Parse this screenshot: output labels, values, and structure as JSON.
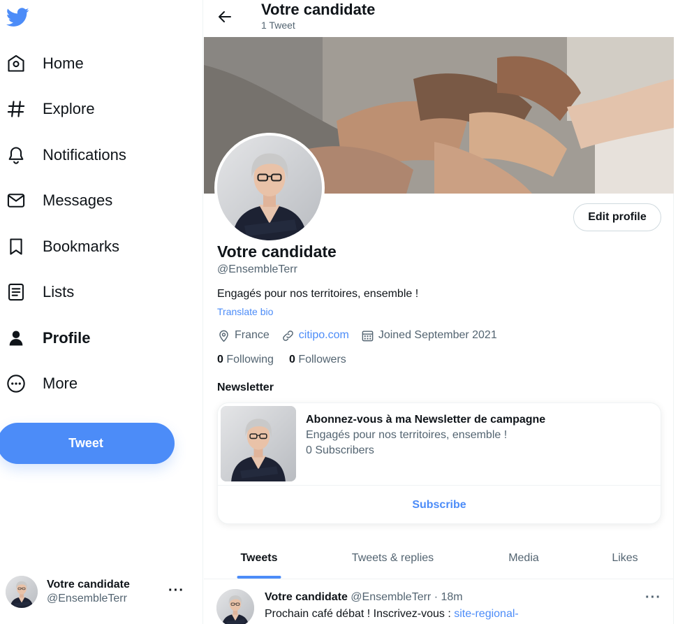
{
  "colors": {
    "accent": "#4c8cf8",
    "text": "#0f1419",
    "muted": "#536471",
    "border": "#eff3f4"
  },
  "sidebar": {
    "logo": "twitter-bird-icon",
    "items": [
      {
        "label": "Home",
        "icon": "home-icon"
      },
      {
        "label": "Explore",
        "icon": "hashtag-icon"
      },
      {
        "label": "Notifications",
        "icon": "bell-icon"
      },
      {
        "label": "Messages",
        "icon": "envelope-icon"
      },
      {
        "label": "Bookmarks",
        "icon": "bookmark-icon"
      },
      {
        "label": "Lists",
        "icon": "list-icon"
      },
      {
        "label": "Profile",
        "icon": "person-icon",
        "active": true
      },
      {
        "label": "More",
        "icon": "more-circle-icon"
      }
    ],
    "tweet_button": "Tweet",
    "account": {
      "name": "Votre candidate",
      "handle": "@EnsembleTerr",
      "more": "···"
    }
  },
  "header": {
    "title": "Votre candidate",
    "subtitle": "1 Tweet"
  },
  "profile": {
    "edit_button": "Edit profile",
    "name": "Votre candidate",
    "handle": "@EnsembleTerr",
    "bio": "Engagés pour nos territoires, ensemble !",
    "translate": "Translate bio",
    "location": "France",
    "website": "citipo.com",
    "joined": "Joined September 2021",
    "following_count": "0",
    "following_label": "Following",
    "followers_count": "0",
    "followers_label": "Followers"
  },
  "newsletter": {
    "section_title": "Newsletter",
    "title": "Abonnez-vous à ma Newsletter de campagne",
    "description": "Engagés pour nos territoires, ensemble !",
    "subscribers": "0 Subscribers",
    "subscribe_button": "Subscribe"
  },
  "tabs": [
    {
      "label": "Tweets",
      "active": true
    },
    {
      "label": "Tweets & replies"
    },
    {
      "label": "Media"
    },
    {
      "label": "Likes"
    }
  ],
  "tweet": {
    "name": "Votre candidate",
    "handle": "@EnsembleTerr",
    "separator": "·",
    "time": "18m",
    "text": "Prochain café débat ! Inscrivez-vous : ",
    "link": "site-regional-",
    "more": "···"
  }
}
